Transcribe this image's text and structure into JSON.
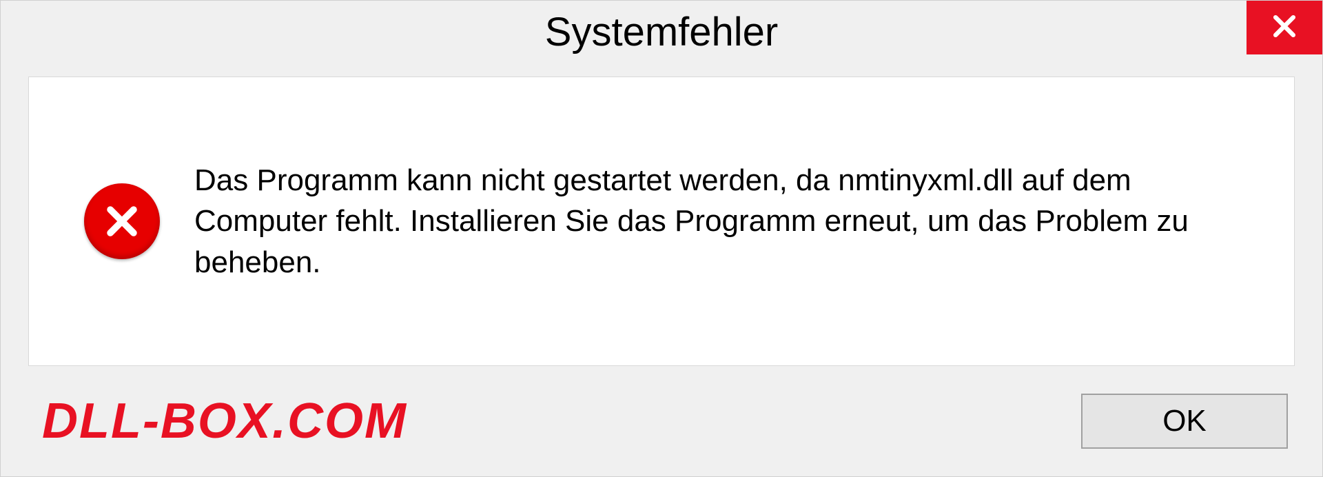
{
  "dialog": {
    "title": "Systemfehler",
    "message": "Das Programm kann nicht gestartet werden, da nmtinyxml.dll auf dem Computer fehlt. Installieren Sie das Programm erneut, um das Problem zu beheben.",
    "ok_label": "OK"
  },
  "watermark": "DLL-BOX.COM",
  "colors": {
    "close_bg": "#e81123",
    "error_icon": "#e60000",
    "watermark": "#e81123"
  }
}
